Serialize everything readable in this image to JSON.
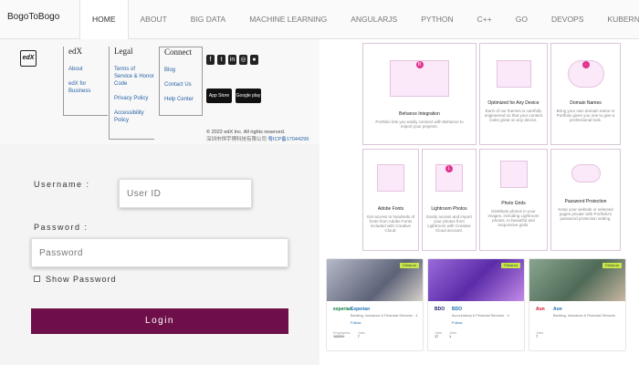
{
  "brand": "BogoToBogo",
  "nav": [
    "HOME",
    "ABOUT",
    "BIG DATA",
    "MACHINE LEARNING",
    "ANGULARJS",
    "PYTHON",
    "C++",
    "GO",
    "DEVOPS",
    "KUBERNETES"
  ],
  "footer": {
    "logo": "edX",
    "col1": {
      "head": "edX",
      "links": [
        "About",
        "edX for Business"
      ]
    },
    "col2": {
      "head": "Legal",
      "links": [
        "Terms of Service & Honor Code",
        "Privacy Policy",
        "Accessibility Policy"
      ]
    },
    "col3": {
      "head": "Connect",
      "links": [
        "Blog",
        "Contact Us",
        "Help Center"
      ]
    },
    "social_icons": [
      "facebook-icon",
      "twitter-icon",
      "linkedin-icon",
      "instagram-icon",
      "reddit-icon"
    ],
    "app_badges": [
      "App Store",
      "Google play"
    ],
    "copyright": "© 2022 edX Inc. All rights reserved.",
    "icp_cn": "深圳市恒宇博科技有限公司",
    "icp_no": "粤ICP备17044299"
  },
  "login": {
    "username_label": "Username :",
    "username_placeholder": "User ID",
    "password_label": "Password :",
    "password_placeholder": "Password",
    "show_password": "Show Password",
    "button": "Login"
  },
  "features": [
    {
      "title": "Behance Integration",
      "desc": "Portfolio lets you easily connect with Behance to import your projects."
    },
    {
      "title": "Optimized for Any Device",
      "desc": "Each of our themes is carefully engineered so that your content looks great on any device."
    },
    {
      "title": "Domain Names",
      "desc": "Bring your own domain name or Portfolio gives you one to give a professional look."
    },
    {
      "title": "Adobe Fonts",
      "desc": "Get access to hundreds of fonts from Adobe Fonts included with Creative Cloud."
    },
    {
      "title": "Lightroom Photos",
      "desc": "Easily access and import your photos from Lightroom with Creative Cloud account."
    },
    {
      "title": "Photo Grids",
      "desc": "Distribute photos in your images, including Lightroom photos, to beautiful and responsive grids."
    },
    {
      "title": "Password Protection",
      "desc": "Keep your website or selected pages private with Portfolio's password protection setting."
    }
  ],
  "companies": [
    {
      "logo": "experian",
      "name": "Experian",
      "desc": "Banking, Insurance & Financial Services · 4",
      "follow": "Follow",
      "stats": [
        {
          "label": "Employees",
          "value": "10000+"
        },
        {
          "label": "Jobs",
          "value": "7"
        }
      ],
      "tag": "Follow us"
    },
    {
      "logo": "BDO",
      "name": "BDO",
      "desc": "Accountancy & Financial Services · 4",
      "follow": "Follow",
      "stats": [
        {
          "label": "Jobs",
          "value": "17"
        },
        {
          "label": "Jobs",
          "value": "1"
        }
      ],
      "tag": "Follow us"
    },
    {
      "logo": "Aon",
      "name": "Aon",
      "desc": "Banking, Insurance & Financial Services",
      "follow": "",
      "stats": [
        {
          "label": "Jobs",
          "value": "7"
        }
      ],
      "tag": "Follow us"
    }
  ],
  "colors": {
    "accent": "#6e0f4a",
    "link": "#2a63a6",
    "pink": "#e0338d"
  }
}
